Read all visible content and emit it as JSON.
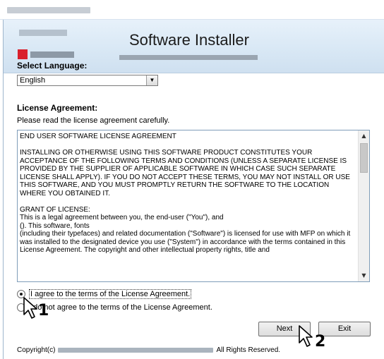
{
  "window": {
    "title_redacted": true
  },
  "banner": {
    "title": "Software Installer"
  },
  "language": {
    "label": "Select Language:",
    "selected": "English"
  },
  "license": {
    "label": "License Agreement:",
    "instruction": "Please read the license agreement carefully.",
    "text": "END USER SOFTWARE LICENSE AGREEMENT\n\nINSTALLING OR OTHERWISE USING THIS SOFTWARE PRODUCT CONSTITUTES YOUR ACCEPTANCE OF THE FOLLOWING TERMS AND CONDITIONS (UNLESS A SEPARATE LICENSE IS PROVIDED BY THE SUPPLIER OF APPLICABLE SOFTWARE IN WHICH CASE SUCH SEPARATE LICENSE SHALL APPLY). IF YOU DO NOT ACCEPT THESE TERMS, YOU MAY NOT INSTALL OR USE THIS SOFTWARE, AND YOU MUST PROMPTLY RETURN THE SOFTWARE TO THE LOCATION WHERE YOU OBTAINED IT.\n\nGRANT OF LICENSE:\nThis is a legal agreement between you, the end-user (\"You\"), and\n(). This software, fonts\n(including their typefaces) and related documentation (\"Software\") is licensed for use with MFP on which it was installed to the designated device you use (\"System\") in accordance with the terms contained in this License Agreement.  The copyright and other intellectual property rights, title and"
  },
  "options": {
    "agree": "I agree to the terms of the License Agreement.",
    "disagree": "I do not agree to the terms of the License Agreement.",
    "selected": "agree"
  },
  "buttons": {
    "next": "Next",
    "exit": "Exit"
  },
  "footer": {
    "copyright_prefix": "Copyright(c)",
    "copyright_suffix": "All Rights Reserved."
  },
  "callouts": {
    "first": "1",
    "second": "2"
  }
}
